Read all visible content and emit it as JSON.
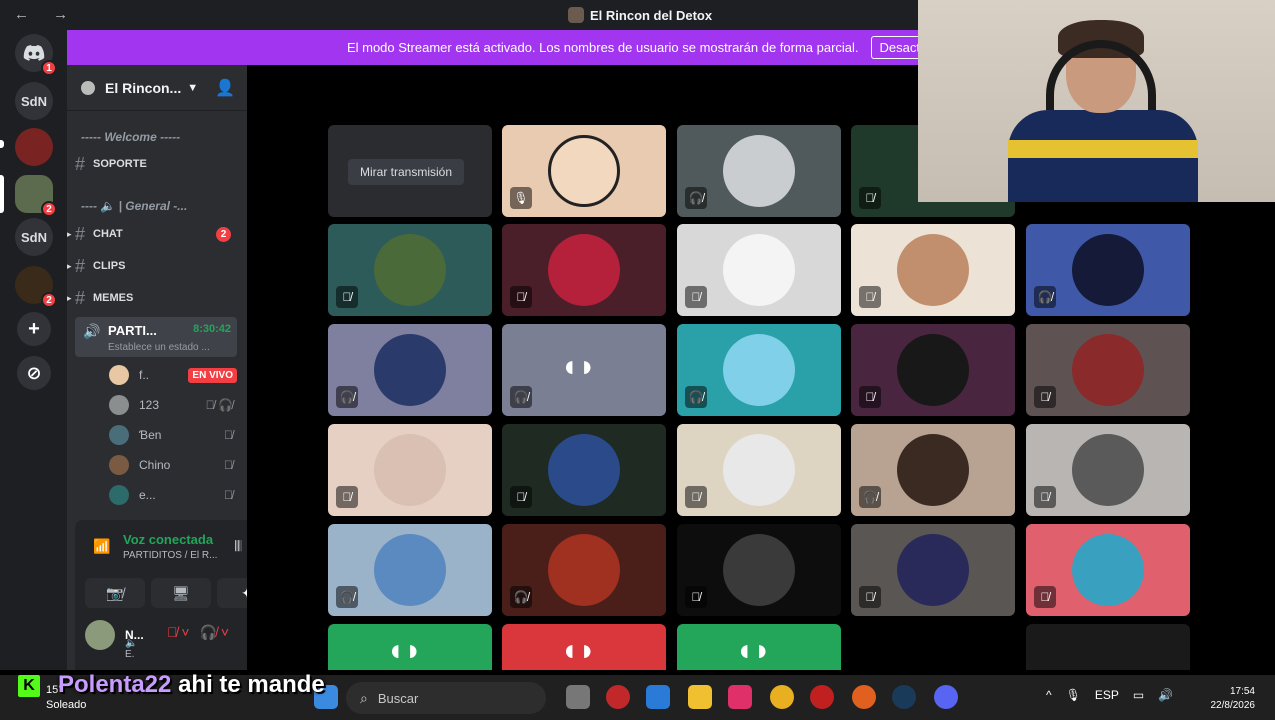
{
  "window": {
    "title": "El Rincon del Detox",
    "nav": "← →"
  },
  "banner": {
    "text": "El modo Streamer está activado. Los nombres de usuario se mostrarán de forma parcial.",
    "button": "Desact"
  },
  "servers": [
    {
      "label": "",
      "icon": "discord-icon",
      "badge": "1"
    },
    {
      "label": "SdN",
      "badge": ""
    },
    {
      "label": "",
      "badge": ""
    },
    {
      "label": "",
      "badge": "2"
    },
    {
      "label": "SdN",
      "badge": ""
    },
    {
      "label": "",
      "badge": "2"
    },
    {
      "label": "+",
      "badge": ""
    },
    {
      "label": "⊘",
      "badge": ""
    }
  ],
  "sidebar": {
    "server_name": "El Rincon...",
    "categories": [
      {
        "label": "----- Welcome -----"
      },
      {
        "label": "---- 🔈 | General -..."
      }
    ],
    "channels": [
      {
        "name": "SOPORTE",
        "badge": ""
      },
      {
        "name": "CHAT",
        "badge": "2"
      },
      {
        "name": "CLIPS",
        "badge": ""
      },
      {
        "name": "MEMES",
        "badge": ""
      }
    ],
    "voice_channel": {
      "name": "PARTI...",
      "time": "8:30:42",
      "status": "Establece un estado ..."
    },
    "members": [
      {
        "name": "f..",
        "live": "EN VIVO"
      },
      {
        "name": "123",
        "live": ""
      },
      {
        "name": "Ɓen",
        "live": ""
      },
      {
        "name": "Chino",
        "live": ""
      },
      {
        "name": "e...",
        "live": ""
      }
    ]
  },
  "voice": {
    "status": "Voz conectada",
    "location": "PARTIDITOS / El R..."
  },
  "user": {
    "name": "N...",
    "sub": "🔈 E."
  },
  "stage": {
    "watch_label": "Mirar transmisión"
  },
  "taskbar": {
    "weather_temp": "15°",
    "weather_text": "Soleado",
    "search_placeholder": "Buscar",
    "lang": "ESP",
    "time": "17:54",
    "date": "22/8/2026"
  },
  "chat_overlay": {
    "user": "Polenta22",
    "message": "ahi te mande"
  }
}
